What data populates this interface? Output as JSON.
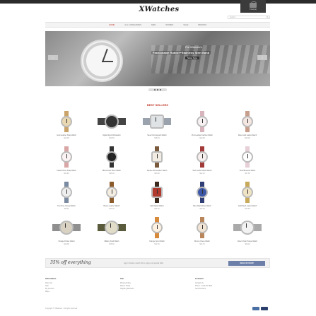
{
  "header": {
    "account_text": "Sign in / Register",
    "cart_count": "0 item(s)",
    "logo": "XWatches",
    "search_placeholder": "Search..."
  },
  "nav": {
    "items": [
      "Home",
      "All Categories",
      "Men",
      "Women",
      "Sale",
      "Brands"
    ]
  },
  "banner": {
    "line1": "For Women's",
    "line2": "Fashionable Rubber+Stainless Steel Band",
    "button": "Shop Now"
  },
  "best_sellers": {
    "title": "BEST SELLERS",
    "products": [
      {
        "name": "Gold Leather Strap Watch",
        "price": "$14.99"
      },
      {
        "name": "Digital Sport Wristwatch",
        "price": "$12.50"
      },
      {
        "name": "Steel Chronograph Watch",
        "price": "$18.40"
      },
      {
        "name": "Pink Leather Fashion Watch",
        "price": "$10.99"
      },
      {
        "name": "Rose Gold Ladies Watch",
        "price": "$15.20"
      },
      {
        "name": "Classic Rose Strap Watch",
        "price": "$11.80"
      },
      {
        "name": "Black Steel Mens Watch",
        "price": "$16.30"
      },
      {
        "name": "Square Dial Leather Watch",
        "price": "$13.90"
      },
      {
        "name": "Red Leather Band Watch",
        "price": "$12.10"
      },
      {
        "name": "Pearl Bracelet Watch",
        "price": "$17.60"
      },
      {
        "name": "Two Tone Casual Watch",
        "price": "$9.99"
      },
      {
        "name": "Brown Leather Watch",
        "price": "$14.20"
      },
      {
        "name": "LED Digital Watch",
        "price": "$11.50"
      },
      {
        "name": "Blue Dial Rubber Watch",
        "price": "$13.40"
      },
      {
        "name": "Gold Mesh Ladies Watch",
        "price": "$16.80"
      },
      {
        "name": "Vintage Pocket Watch",
        "price": "$19.90"
      },
      {
        "name": "Military Field Watch",
        "price": "$15.60"
      },
      {
        "name": "Orange Sport Watch",
        "price": "$12.30"
      },
      {
        "name": "Bronze Dress Watch",
        "price": "$14.70"
      },
      {
        "name": "Silver Chain Pocket Watch",
        "price": "$18.10"
      }
    ]
  },
  "promo": {
    "headline": "35% off everything",
    "subtext": "sign in before march 31 to enjoy our special offer",
    "button": "SIGN IN NOW"
  },
  "footer": {
    "columns": [
      {
        "title": "Information",
        "links": [
          "About Us",
          "Sale",
          "My Account",
          "Ways"
        ]
      },
      {
        "title": "Info",
        "links": [
          "Privacy Policy",
          "Return Policy",
          "Shipping Methods"
        ]
      },
      {
        "title": "Contacts",
        "links": [
          "Contact Us",
          "Phone: 1-234-567-890",
          "Get Directions"
        ]
      }
    ],
    "copyright": "Copyright © XWatches - All rights reserved"
  },
  "colors": {
    "accent": "#c0392b",
    "button": "#6b7fa8",
    "topbar": "#2b2b2b"
  }
}
